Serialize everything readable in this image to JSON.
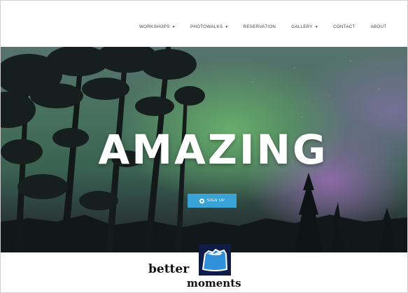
{
  "nav": {
    "items": [
      {
        "label": "WORKSHOPS",
        "has_dropdown": true,
        "caret": "▾"
      },
      {
        "label": "PHOTOWALKS",
        "has_dropdown": true,
        "caret": "▾"
      },
      {
        "label": "RESERVATION",
        "has_dropdown": false,
        "caret": ""
      },
      {
        "label": "GALLERY",
        "has_dropdown": true,
        "caret": "▾"
      },
      {
        "label": "CONTACT",
        "has_dropdown": false,
        "caret": ""
      },
      {
        "label": "ABOUT",
        "has_dropdown": false,
        "caret": ""
      }
    ]
  },
  "hero": {
    "title": "AMAZING",
    "cta_label": "SIGN UP",
    "cta_icon": "circle-icon"
  },
  "logo": {
    "line1": "better",
    "line2": "moments",
    "colors": {
      "box": "#0e1c47",
      "shape": "#2f8fd8",
      "shape_outline": "#ffffff"
    }
  },
  "colors": {
    "accent": "#3aa3d6",
    "nav_text": "#444444",
    "aurora_green": "#78c878",
    "aurora_purple": "#aa78c8"
  }
}
